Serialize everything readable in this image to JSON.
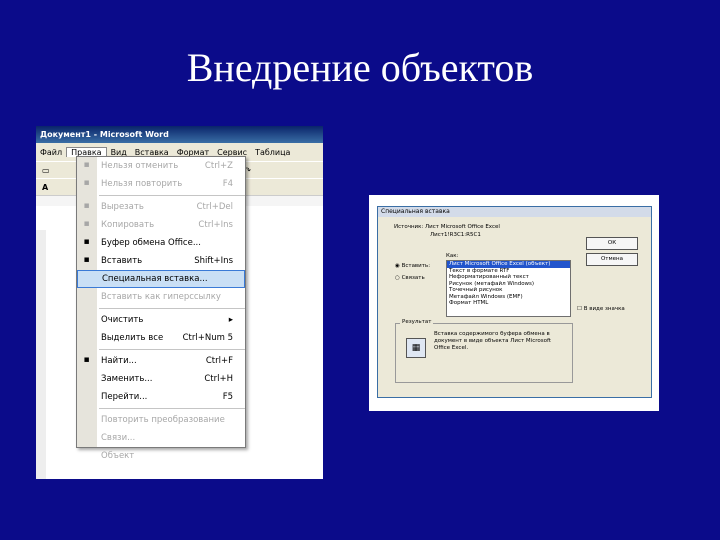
{
  "slide": {
    "title": "Внедрение объектов"
  },
  "word": {
    "window_title": "Документ1 - Microsoft Word",
    "menubar": [
      "Файл",
      "Правка",
      "Вид",
      "Вставка",
      "Формат",
      "Сервис",
      "Таблица"
    ],
    "active_menu": "Правка",
    "font_size": "12",
    "edit_menu": [
      {
        "label": "Нельзя отменить",
        "shortcut": "Ctrl+Z",
        "disabled": true,
        "icon": "undo-icon"
      },
      {
        "label": "Нельзя повторить",
        "shortcut": "F4",
        "disabled": true,
        "icon": "redo-icon"
      },
      {
        "sep": true
      },
      {
        "label": "Вырезать",
        "shortcut": "Ctrl+Del",
        "disabled": true,
        "icon": "cut-icon"
      },
      {
        "label": "Копировать",
        "shortcut": "Ctrl+Ins",
        "disabled": true,
        "icon": "copy-icon"
      },
      {
        "label": "Буфер обмена Office...",
        "shortcut": "",
        "disabled": false,
        "icon": "clipboard-icon"
      },
      {
        "label": "Вставить",
        "shortcut": "Shift+Ins",
        "disabled": false,
        "icon": "paste-icon"
      },
      {
        "label": "Специальная вставка...",
        "shortcut": "",
        "disabled": false,
        "highlight": true
      },
      {
        "label": "Вставить как гиперссылку",
        "shortcut": "",
        "disabled": true
      },
      {
        "sep": true
      },
      {
        "label": "Очистить",
        "shortcut": "▸",
        "disabled": false
      },
      {
        "label": "Выделить все",
        "shortcut": "Ctrl+Num 5",
        "disabled": false
      },
      {
        "sep": true
      },
      {
        "label": "Найти...",
        "shortcut": "Ctrl+F",
        "disabled": false,
        "icon": "find-icon"
      },
      {
        "label": "Заменить...",
        "shortcut": "Ctrl+H",
        "disabled": false
      },
      {
        "label": "Перейти...",
        "shortcut": "F5",
        "disabled": false
      },
      {
        "sep": true
      },
      {
        "label": "Повторить преобразование",
        "shortcut": "",
        "disabled": true
      },
      {
        "label": "Связи...",
        "shortcut": "",
        "disabled": true
      },
      {
        "label": "Объект",
        "shortcut": "",
        "disabled": true
      }
    ]
  },
  "dialog": {
    "title": "Специальная вставка",
    "source_label": "Источник: Лист Microsoft Office Excel",
    "source_sub": "Лист1!R3C1:R5C1",
    "as_label": "Как:",
    "paste_label": "Вставить:",
    "link_label": "Связать",
    "formats": [
      "Лист Microsoft Office Excel (объект)",
      "Текст в формате RTF",
      "Неформатированный текст",
      "Рисунок (метафайл Windows)",
      "Точечный рисунок",
      "Метафайл Windows (EMF)",
      "Формат HTML"
    ],
    "ok_label": "ОК",
    "cancel_label": "Отмена",
    "as_icon_label": "В виде значка",
    "result_label": "Результат",
    "result_text": "Вставка содержимого буфера обмена в документ в виде объекта Лист Microsoft Office Excel."
  }
}
